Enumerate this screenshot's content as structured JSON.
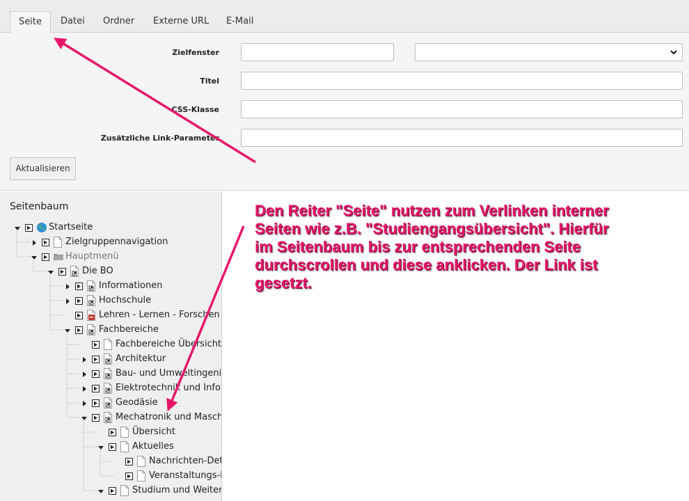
{
  "tabs": [
    "Seite",
    "Datei",
    "Ordner",
    "Externe URL",
    "E-Mail"
  ],
  "form": {
    "target_label": "Zielfenster",
    "target_value": "",
    "target_select_value": "",
    "title_label": "Titel",
    "title_value": "",
    "css_label": "CSS-Klasse",
    "css_value": "",
    "params_label": "Zusätzliche Link-Parameter",
    "params_value": "",
    "update_button": "Aktualisieren"
  },
  "tree": {
    "title": "Seitenbaum",
    "items": [
      {
        "label": "Startseite",
        "depth": 0,
        "toggle": "open",
        "icon": "globe-icon"
      },
      {
        "label": "Zielgruppennavigation",
        "depth": 1,
        "toggle": "closed",
        "icon": "page-icon"
      },
      {
        "label": "Hauptmenü",
        "depth": 1,
        "toggle": "open",
        "icon": "folder-icon",
        "muted": true
      },
      {
        "label": "Die BO",
        "depth": 2,
        "toggle": "open",
        "icon": "shortcut-page-icon"
      },
      {
        "label": "Informationen",
        "depth": 3,
        "toggle": "closed",
        "icon": "shortcut-page-icon"
      },
      {
        "label": "Hochschule",
        "depth": 3,
        "toggle": "closed",
        "icon": "shortcut-page-icon"
      },
      {
        "label": "Lehren - Lernen - Forschen",
        "depth": 3,
        "toggle": "none",
        "icon": "restricted-page-icon"
      },
      {
        "label": "Fachbereiche",
        "depth": 3,
        "toggle": "open",
        "icon": "shortcut-page-icon"
      },
      {
        "label": "Fachbereiche Übersicht",
        "depth": 4,
        "toggle": "none",
        "icon": "page-icon"
      },
      {
        "label": "Architektur",
        "depth": 4,
        "toggle": "closed",
        "icon": "shortcut-page-icon"
      },
      {
        "label": "Bau- und Umweltingenieurwesen",
        "depth": 4,
        "toggle": "closed",
        "icon": "shortcut-page-icon"
      },
      {
        "label": "Elektrotechnik und Informatik",
        "depth": 4,
        "toggle": "closed",
        "icon": "shortcut-page-icon"
      },
      {
        "label": "Geodäsie",
        "depth": 4,
        "toggle": "closed",
        "icon": "shortcut-page-icon"
      },
      {
        "label": "Mechatronik und Maschinenbau",
        "depth": 4,
        "toggle": "open",
        "icon": "shortcut-page-icon"
      },
      {
        "label": "Übersicht",
        "depth": 5,
        "toggle": "none",
        "icon": "page-icon"
      },
      {
        "label": "Aktuelles",
        "depth": 5,
        "toggle": "open",
        "icon": "page-icon"
      },
      {
        "label": "Nachrichten-Detail",
        "depth": 6,
        "toggle": "none",
        "icon": "page-icon"
      },
      {
        "label": "Veranstaltungs-Detail",
        "depth": 6,
        "toggle": "none",
        "icon": "page-icon"
      },
      {
        "label": "Studium und Weiterbildung",
        "depth": 5,
        "toggle": "open",
        "icon": "page-icon"
      }
    ]
  },
  "annotation": {
    "text": "Den Reiter \"Seite\" nutzen zum Verlinken interner\nSeiten wie z.B. \"Studiengangsübersicht\". Hierfür\nim Seitenbaum bis zur entsprechenden Seite\ndurchscrollen und diese anklicken. Der Link ist\ngesetzt.",
    "color": "#e6176b"
  },
  "colors": {
    "accent": "#e6176b",
    "globe": "#2f8fd6",
    "restricted": "#c0392b"
  }
}
